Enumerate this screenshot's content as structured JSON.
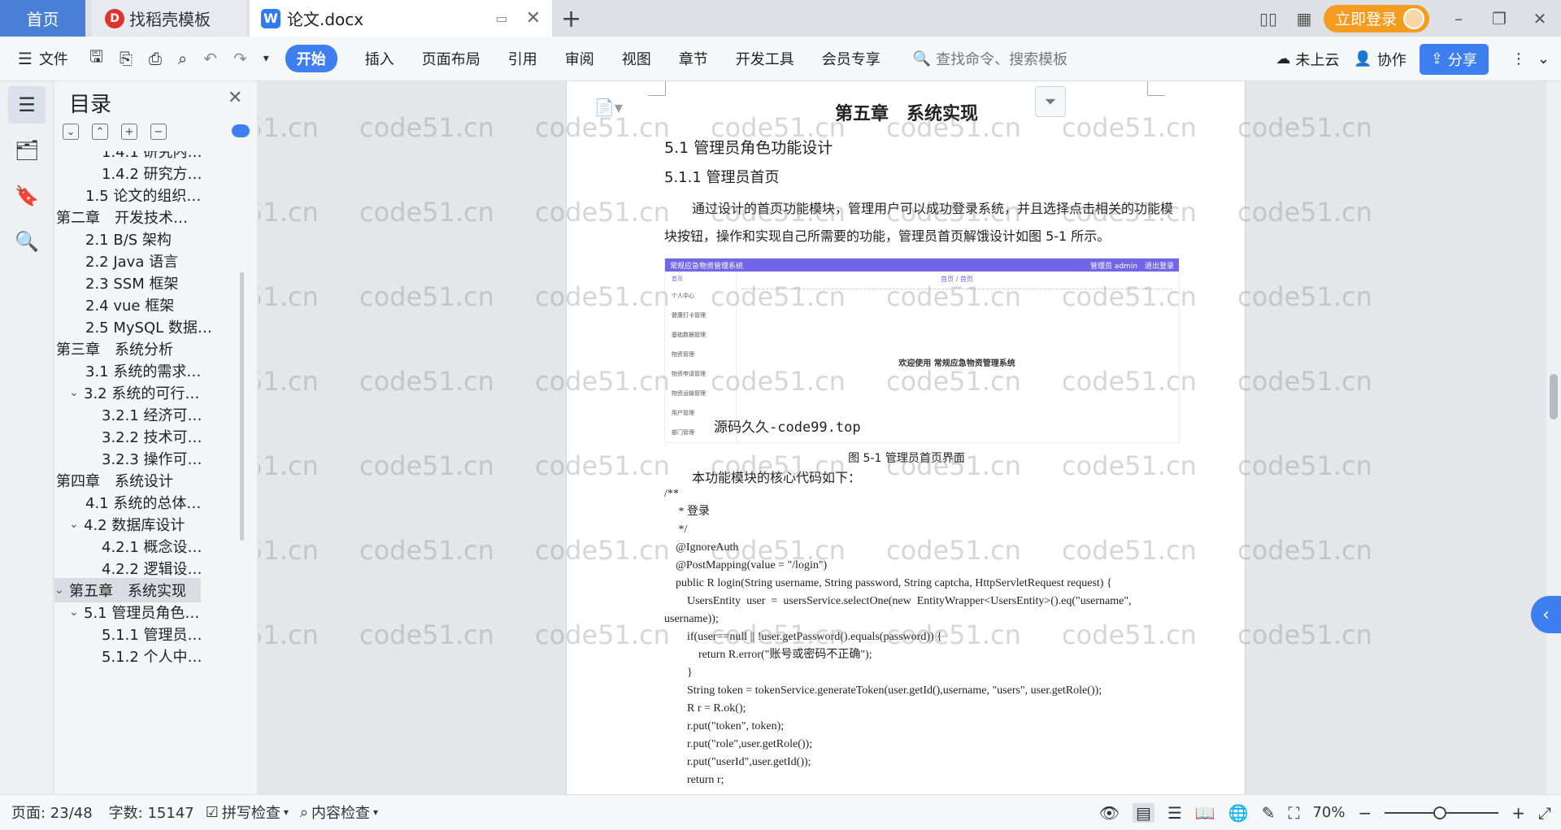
{
  "titlebar": {
    "tabs": [
      {
        "label": "首页"
      },
      {
        "label": "找稻壳模板"
      },
      {
        "label": "论文.docx"
      }
    ],
    "login_label": "立即登录"
  },
  "ribbon": {
    "file_label": "文件",
    "tabs": [
      "开始",
      "插入",
      "页面布局",
      "引用",
      "审阅",
      "视图",
      "章节",
      "开发工具",
      "会员专享"
    ],
    "active_tab": "开始",
    "search_placeholder": "查找命令、搜索模板",
    "cloud_label": "未上云",
    "collab_label": "协作",
    "share_label": "分享"
  },
  "nav": {
    "title": "目录",
    "toc": [
      {
        "label": "1.4.1 研究内…",
        "level": 3
      },
      {
        "label": "1.4.2 研究方…",
        "level": 3
      },
      {
        "label": "1.5 论文的组织…",
        "level": 2
      },
      {
        "label": "第二章　开发技术…",
        "level": 1,
        "expanded": true
      },
      {
        "label": "2.1 B/S 架构",
        "level": 2
      },
      {
        "label": "2.2 Java 语言",
        "level": 2
      },
      {
        "label": "2.3 SSM 框架",
        "level": 2
      },
      {
        "label": "2.4 vue 框架",
        "level": 2
      },
      {
        "label": "2.5 MySQL 数据…",
        "level": 2
      },
      {
        "label": "第三章　系统分析",
        "level": 1,
        "expanded": true
      },
      {
        "label": "3.1 系统的需求…",
        "level": 2
      },
      {
        "label": "3.2 系统的可行…",
        "level": 2,
        "expanded": true
      },
      {
        "label": "3.2.1 经济可…",
        "level": 3
      },
      {
        "label": "3.2.2 技术可…",
        "level": 3
      },
      {
        "label": "3.2.3 操作可…",
        "level": 3
      },
      {
        "label": "第四章　系统设计",
        "level": 1,
        "expanded": true
      },
      {
        "label": "4.1 系统的总体…",
        "level": 2
      },
      {
        "label": "4.2 数据库设计",
        "level": 2,
        "expanded": true
      },
      {
        "label": "4.2.1 概念设…",
        "level": 3
      },
      {
        "label": "4.2.2 逻辑设…",
        "level": 3
      },
      {
        "label": "第五章　系统实现",
        "level": 1,
        "expanded": true,
        "selected": true
      },
      {
        "label": "5.1 管理员角色…",
        "level": 2,
        "expanded": true
      },
      {
        "label": "5.1.1 管理员…",
        "level": 3
      },
      {
        "label": "5.1.2 个人中…",
        "level": 3
      }
    ]
  },
  "document": {
    "chapter_title": "第五章　系统实现",
    "h2": "5.1 管理员角色功能设计",
    "h3": "5.1.1 管理员首页",
    "paragraph": "通过设计的首页功能模块，管理用户可以成功登录系统，并且选择点击相关的功能模块按钮，操作和实现自己所需要的功能，管理员首页解饿设计如图 5-1 所示。",
    "figure": {
      "app_title": "常规应急物资管理系统",
      "user_info": "管理员 admin　退出登录",
      "nav_head": "首页",
      "breadcrumb": "首页 / 首页",
      "menu": [
        "首页",
        "个人中心",
        "健康打卡管理",
        "基础数据管理",
        "物资管理",
        "物资申请管理",
        "物资运输管理",
        "用户管理",
        "部门管理"
      ],
      "welcome": "欢迎使用 常规应急物资管理系统",
      "overlay_watermark": "源码久久-code99.top"
    },
    "caption": "图 5-1 管理员首页界面",
    "intro": "本功能模块的核心代码如下：",
    "code_lines": [
      "/**",
      "     * 登录",
      "     */",
      "    @IgnoreAuth",
      "    @PostMapping(value = \"/login\")",
      "    public R login(String username, String password, String captcha, HttpServletRequest request) {",
      "        UsersEntity  user  =  usersService.selectOne(new  EntityWrapper<UsersEntity>().eq(\"username\",",
      "username));",
      "        if(user==null || !user.getPassword().equals(password)) {",
      "            return R.error(\"账号或密码不正确\");",
      "        }",
      "        String token = tokenService.generateToken(user.getId(),username, \"users\", user.getRole());",
      "        R r = R.ok();",
      "        r.put(\"token\", token);",
      "        r.put(\"role\",user.getRole());",
      "        r.put(\"userId\",user.getId());",
      "        return r;"
    ],
    "watermark_text": "code51.cn"
  },
  "status": {
    "page": "页面: 23/48",
    "words": "字数: 15147",
    "spell": "拼写检查",
    "content_check": "内容检查",
    "zoom": "70%"
  },
  "colors": {
    "accent": "#3d7ff0",
    "login": "#f39c1f",
    "figure_bar": "#6f67e8"
  }
}
